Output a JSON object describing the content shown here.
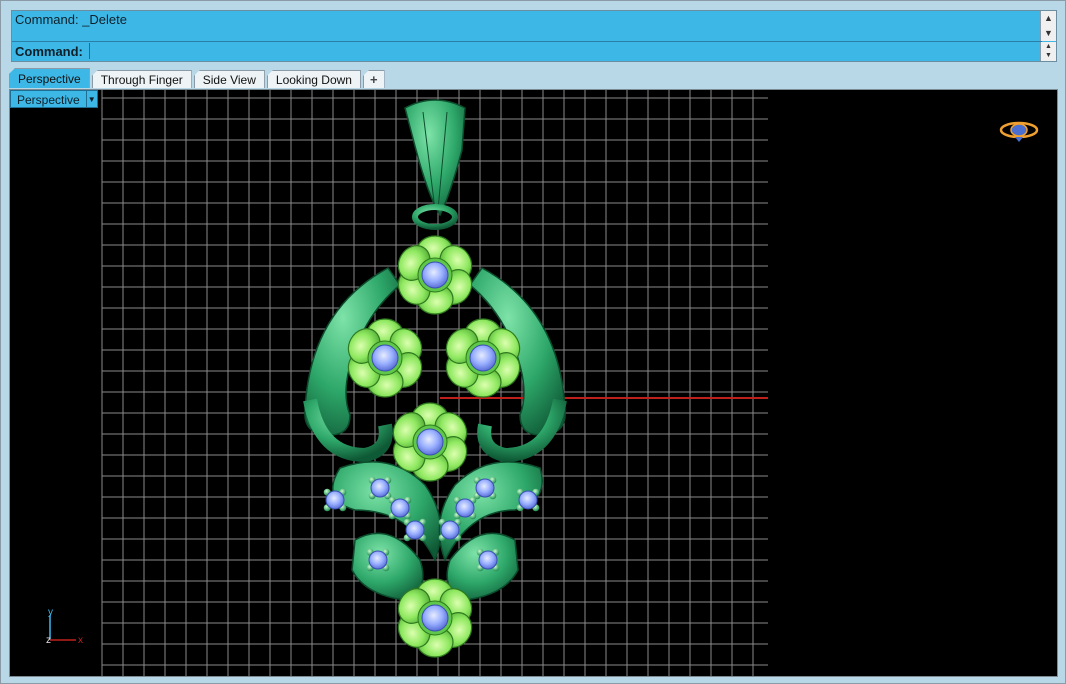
{
  "command": {
    "history": "Command: _Delete",
    "label": "Command:",
    "input_value": ""
  },
  "tabs": [
    {
      "label": "Perspective",
      "active": true
    },
    {
      "label": "Through Finger",
      "active": false
    },
    {
      "label": "Side View",
      "active": false
    },
    {
      "label": "Looking Down",
      "active": false
    },
    {
      "label": "+",
      "active": false
    }
  ],
  "viewport": {
    "name": "Perspective",
    "axes": {
      "x": "x",
      "y": "y",
      "z": "z"
    }
  },
  "colors": {
    "command_bg": "#3db8e6",
    "tab_active": "#3db8e6",
    "viewport_bg": "#000000",
    "grid": "#bfbfbf",
    "x_axis": "#c0201c",
    "metal_green": "#2ea86a",
    "flower_green": "#7fe05a",
    "gem_blue": "#8fa8ff"
  },
  "icons": [
    "scroll-up-icon",
    "scroll-down-icon",
    "spin-up-icon",
    "spin-down-icon",
    "viewport-menu-arrow-icon",
    "add-tab-icon",
    "axis-gizmo-icon",
    "nav-orbit-icon"
  ]
}
